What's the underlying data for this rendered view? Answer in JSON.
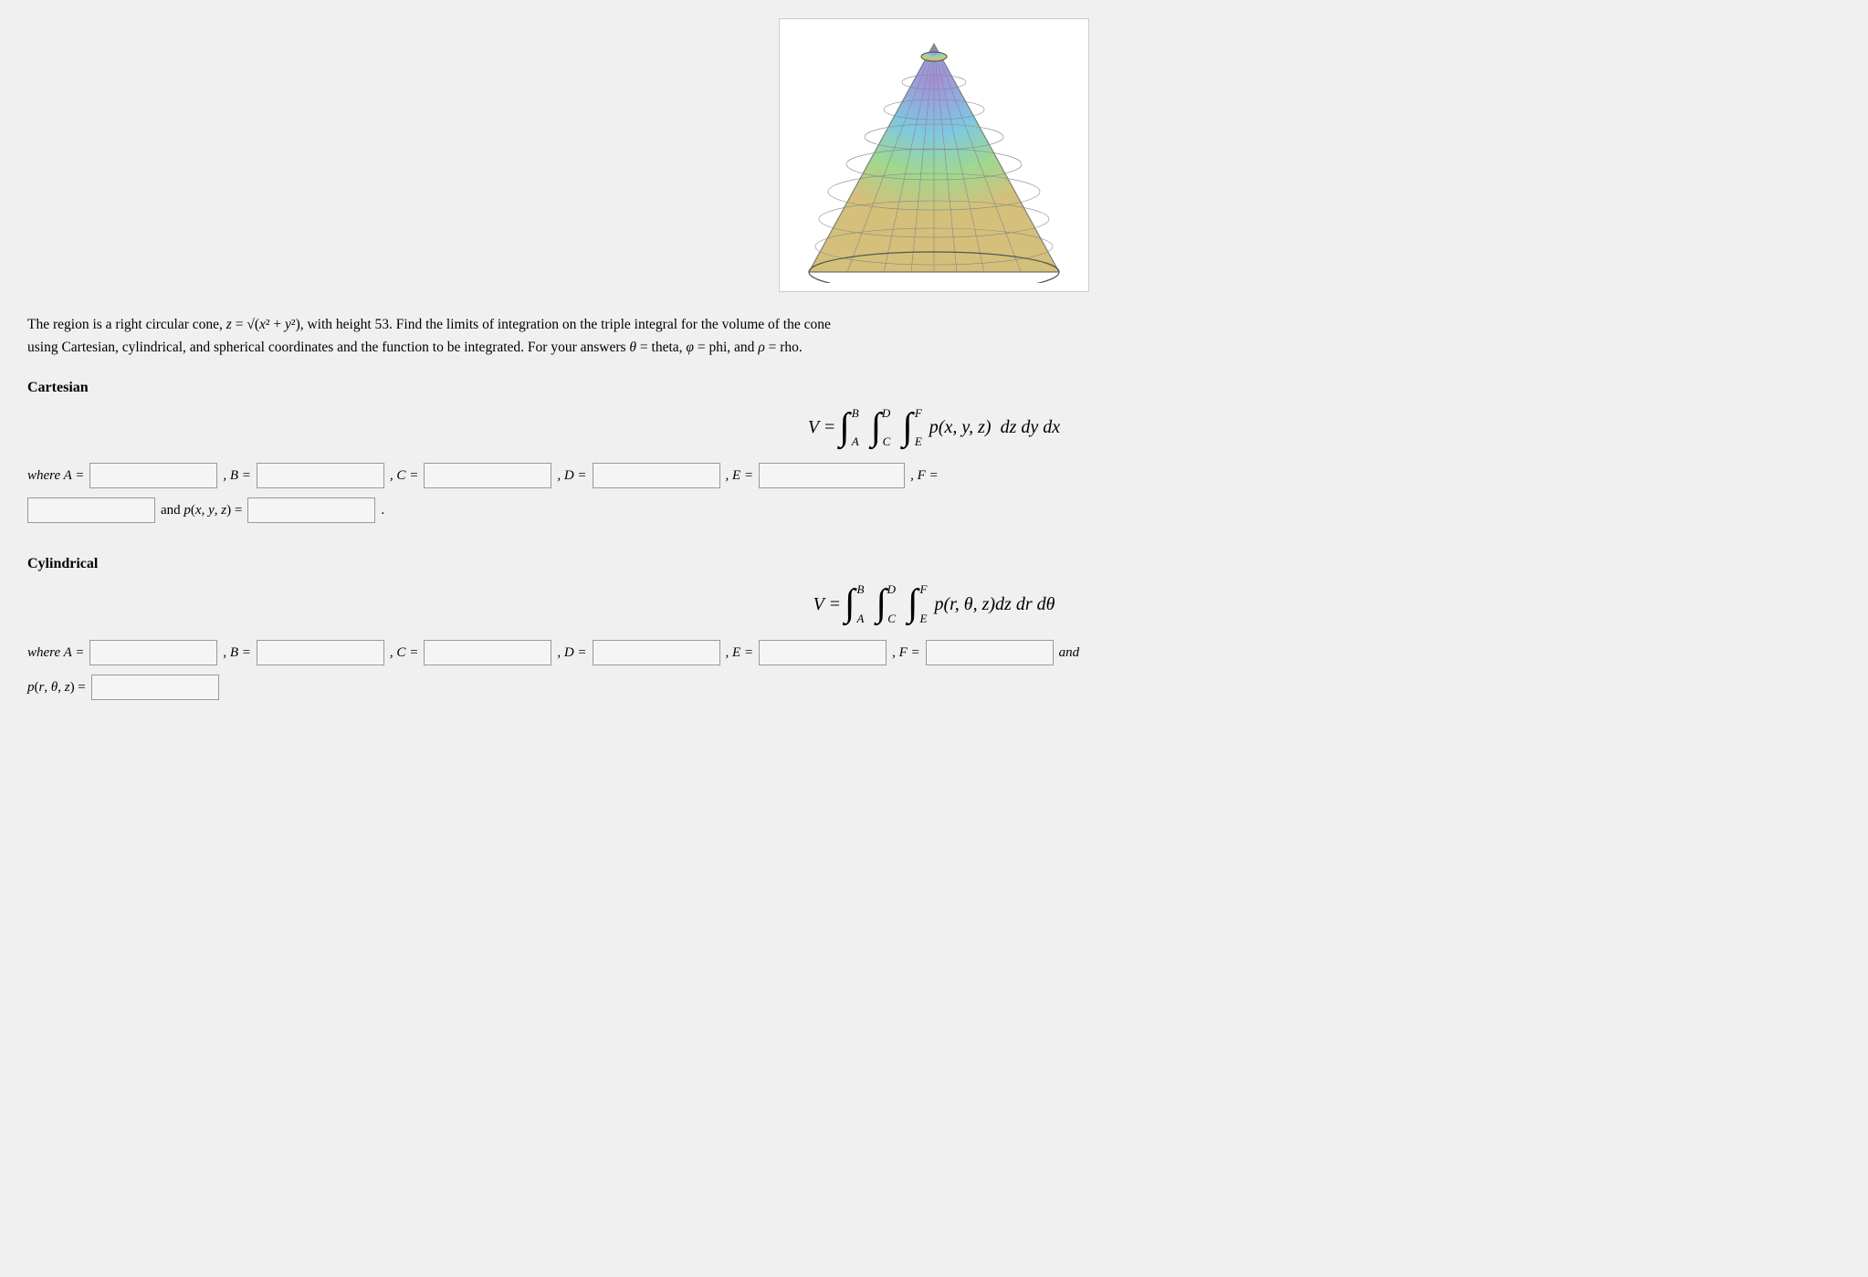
{
  "cone_image_alt": "3D cone visualization",
  "problem_text": {
    "line1": "The region is a right circular cone, z = √(x² + y²), with height 53. Find the limits of integration on the triple integral for the volume of the cone",
    "line2": "using Cartesian, cylindrical, and spherical coordinates and the function to be integrated. For your answers θ = theta, φ = phi, and ρ = rho."
  },
  "sections": {
    "cartesian": {
      "title": "Cartesian",
      "formula_label": "V =",
      "limits": {
        "A": "",
        "B": "",
        "C": "",
        "D": "",
        "E": "",
        "F": ""
      },
      "integrand_label": "p(x, y, z) =",
      "integrand_value": "",
      "where_label": "where A =",
      "B_label": ", B =",
      "C_label": ", C =",
      "D_label": ", D =",
      "E_label": ", E =",
      "F_label": ", F =",
      "and_label": "and p(x, y, z) ="
    },
    "cylindrical": {
      "title": "Cylindrical",
      "formula_label": "V =",
      "limits": {
        "A": "",
        "B": "",
        "C": "",
        "D": "",
        "E": "",
        "F": ""
      },
      "integrand_value": "",
      "where_label": "where A =",
      "B_label": ", B =",
      "C_label": ", C =",
      "D_label": ", D =",
      "E_label": ", E =",
      "F_label": ", F =",
      "and_label": "and",
      "p_label": "p(r, θ, z) ="
    }
  }
}
